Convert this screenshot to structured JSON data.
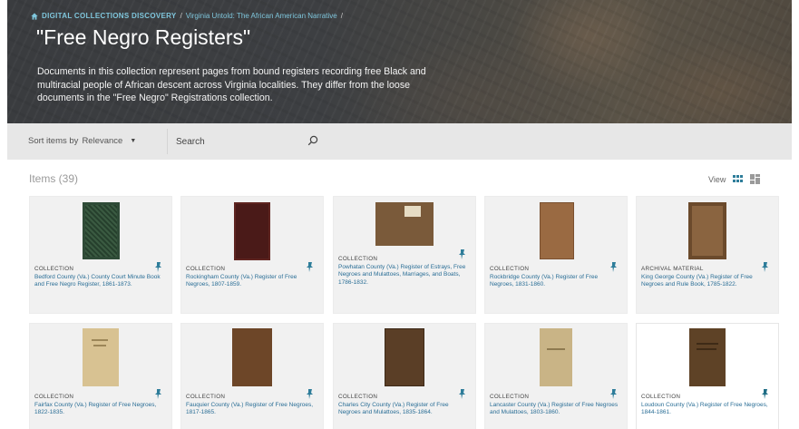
{
  "breadcrumb": {
    "home": "DIGITAL COLLECTIONS DISCOVERY",
    "separator": "/",
    "parent": "Virginia Untold: The African American Narrative",
    "trailing": "/"
  },
  "hero": {
    "title": "\"Free Negro Registers\"",
    "description": "Documents in this collection represent pages from bound registers recording free Black and multiracial people of African descent across Virginia localities. They differ from the loose documents in the \"Free Negro\" Registrations collection."
  },
  "toolbar": {
    "sort_label": "Sort items by",
    "sort_value": "Relevance",
    "search_placeholder": "Search"
  },
  "items": {
    "header": "Items (39)",
    "view_label": "View",
    "cards": [
      {
        "type": "COLLECTION",
        "title": "Bedford County (Va.) County Court Minute Book and Free Negro Register, 1861-1873.",
        "thumb_color": "#2f4b37"
      },
      {
        "type": "COLLECTION",
        "title": "Rockingham County (Va.) Register of Free Negroes, 1807-1859.",
        "thumb_color": "#4a1a18"
      },
      {
        "type": "COLLECTION",
        "title": "Powhatan County (Va.) Register of Estrays, Free Negroes and Mulattoes, Marriages, and Boats, 1786-1832.",
        "thumb_color": "#7a5a3a"
      },
      {
        "type": "COLLECTION",
        "title": "Rockbridge County (Va.) Register of Free Negroes, 1831-1860.",
        "thumb_color": "#9a6a42"
      },
      {
        "type": "ARCHIVAL MATERIAL",
        "title": "King George County (Va.) Register of Free Negroes and Rule Book, 1785-1822.",
        "thumb_color": "#6b4a2c"
      },
      {
        "type": "COLLECTION",
        "title": "Fairfax County (Va.) Register of Free Negroes, 1822-1835.",
        "thumb_color": "#d8c292"
      },
      {
        "type": "COLLECTION",
        "title": "Fauquier County (Va.) Register of Free Negroes, 1817-1865.",
        "thumb_color": "#6d4628"
      },
      {
        "type": "COLLECTION",
        "title": "Charles City County (Va.) Register of Free Negroes and Mulattoes, 1835-1864.",
        "thumb_color": "#5a3e26"
      },
      {
        "type": "COLLECTION",
        "title": "Lancaster County (Va.) Register of Free Negroes and Mulattoes, 1803-1860.",
        "thumb_color": "#c9b486"
      },
      {
        "type": "COLLECTION",
        "title": "Loudoun County (Va.) Register of Free Negroes, 1844-1861.",
        "thumb_color": "#5e4226"
      }
    ]
  },
  "colors": {
    "link": "#2a6e96",
    "accent": "#2e7d9a",
    "breadcrumb": "#7fc6dc",
    "toolbar_bg": "#e7e7e7",
    "card_bg": "#f1f1f1"
  },
  "icons": {
    "home": "home-icon",
    "search": "search-icon",
    "sort_dropdown": "caret-down-icon",
    "grid_view": "grid-view-icon",
    "gallery_view": "masonry-view-icon",
    "pin": "pin-icon"
  }
}
